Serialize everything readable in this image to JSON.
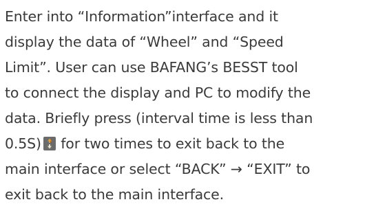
{
  "paragraph": {
    "line1": "Enter into “Information”interface and it",
    "line2": "display the data of “Wheel” and “Speed",
    "line3": "Limit”. User can use BAFANG’s BESST tool",
    "line4": "to connect the display and PC to modify the",
    "line5": "data. Briefly press (interval time is less than",
    "line6_before_icon": "0.5S)",
    "line6_after_icon": " for two times to exit back to the",
    "line7": "main interface or select “BACK” → “EXIT” to",
    "line8": "exit back to the main interface."
  },
  "icon": {
    "name": "up-down-arrow-button-icon",
    "background": "#6b6b6b",
    "arrow_up": "#e89b2d",
    "arrow_down": "#e8e0c8"
  }
}
